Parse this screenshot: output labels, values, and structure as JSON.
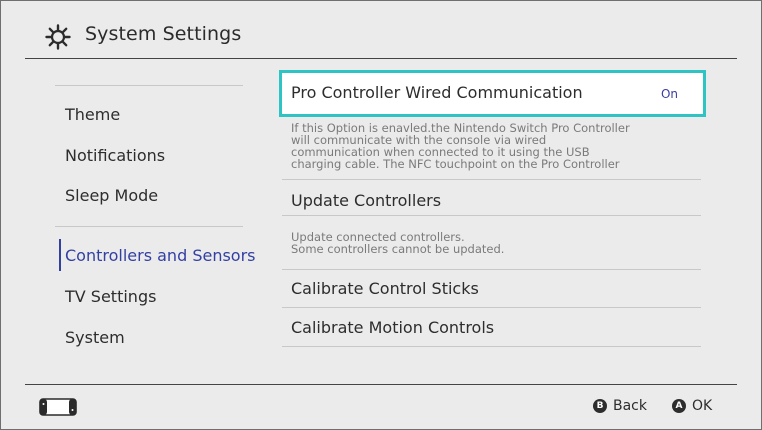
{
  "header": {
    "title": "System Settings",
    "icon": "gear-icon"
  },
  "sidebar": {
    "items": [
      {
        "label": "Theme"
      },
      {
        "label": "Notifications"
      },
      {
        "label": "Sleep Mode"
      },
      {
        "label": "Controllers and Sensors",
        "active": true
      },
      {
        "label": "TV Settings"
      },
      {
        "label": "System"
      }
    ]
  },
  "main": {
    "rows": [
      {
        "label": "Pro Controller Wired Communication",
        "value": "On",
        "selected": true,
        "description": "If this Option is enavled.the Nintendo Switch Pro Controller\nwill communicate with the console via wired\ncommunication when connected to it using the USB\ncharging cable. The NFC touchpoint on the Pro Controller"
      },
      {
        "label": "Update Controllers",
        "description": "Update connected controllers.\nSome controllers cannot be updated."
      },
      {
        "label": "Calibrate Control Sticks"
      },
      {
        "label": "Calibrate Motion Controls"
      }
    ]
  },
  "footer": {
    "back": {
      "button": "B",
      "label": "Back"
    },
    "ok": {
      "button": "A",
      "label": "OK"
    },
    "console_icon": "console-icon"
  },
  "colors": {
    "accent": "#3340a3",
    "selection": "#2ec4c4",
    "background": "#ebebeb"
  }
}
